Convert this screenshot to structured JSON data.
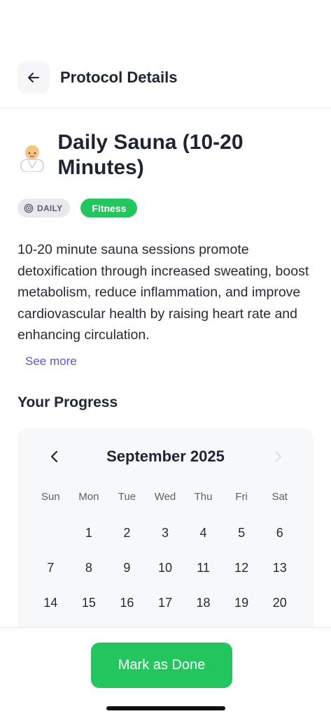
{
  "header": {
    "title": "Protocol Details",
    "back_icon": "arrow-left-icon"
  },
  "protocol": {
    "emoji": "🧖‍♂️",
    "title": "Daily Sauna (10-20 Minutes)",
    "frequency_badge": "DAILY",
    "category_badge": "Fitness",
    "description": "10-20 minute sauna sessions promote detoxification through increased sweating, boost metabolism, reduce inflammation, and improve cardiovascular health by raising heart rate and enhancing circulation.",
    "see_more": "See more"
  },
  "progress": {
    "title": "Your Progress",
    "calendar": {
      "month_label": "September 2025",
      "weekdays": [
        "Sun",
        "Mon",
        "Tue",
        "Wed",
        "Thu",
        "Fri",
        "Sat"
      ],
      "days": [
        "",
        "1",
        "2",
        "3",
        "4",
        "5",
        "6",
        "7",
        "8",
        "9",
        "10",
        "11",
        "12",
        "13",
        "14",
        "15",
        "16",
        "17",
        "18",
        "19",
        "20"
      ]
    }
  },
  "footer": {
    "button_label": "Mark as Done"
  },
  "colors": {
    "accent_green": "#23c55e",
    "link_purple": "#5b57c9",
    "text_dark": "#1f2433",
    "badge_grey": "#e8e9ec"
  }
}
